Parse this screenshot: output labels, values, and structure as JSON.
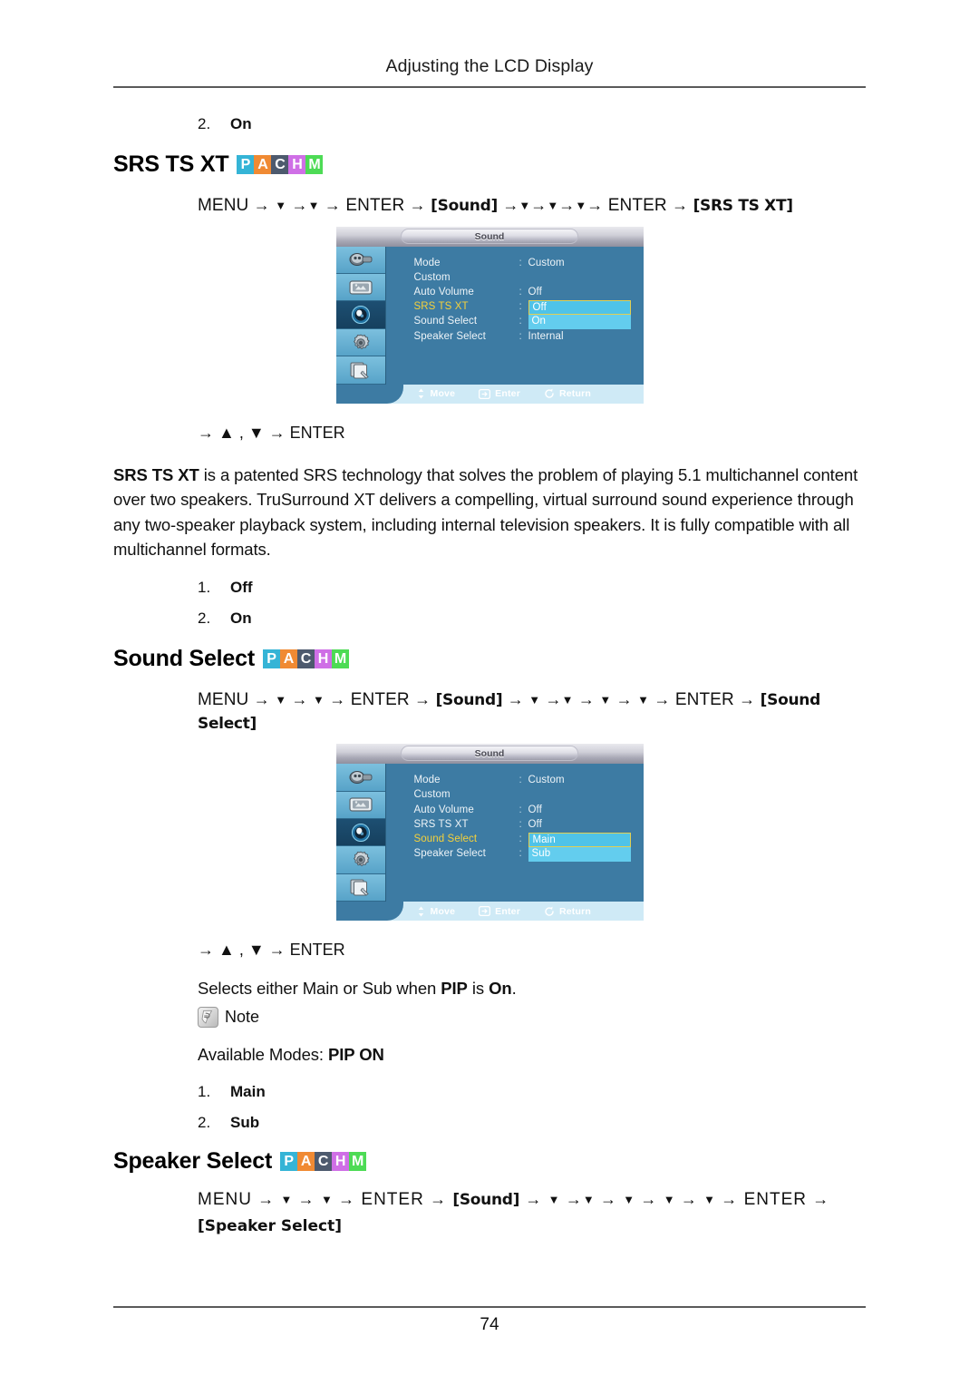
{
  "header": {
    "title": "Adjusting the LCD Display"
  },
  "footer": {
    "page_number": "74"
  },
  "badge_colors": {
    "P": "#35b4d6",
    "A": "#f08a33",
    "C": "#4d5a6e",
    "H": "#cf6fe6",
    "M": "#4ddb55"
  },
  "badges": [
    {
      "letter": "P",
      "name": "badge-p"
    },
    {
      "letter": "A",
      "name": "badge-a"
    },
    {
      "letter": "C",
      "name": "badge-c"
    },
    {
      "letter": "H",
      "name": "badge-h"
    },
    {
      "letter": "M",
      "name": "badge-m"
    }
  ],
  "top_list": {
    "num": "2.",
    "value": "On"
  },
  "srs": {
    "heading": "SRS TS XT",
    "path": {
      "menu": "MENU",
      "enter1": "ENTER",
      "sound": "[Sound]",
      "enter2": "ENTER",
      "target": "[SRS TS XT]",
      "arrow": "→",
      "down": "▼"
    },
    "kbd_line": "→ ▲ , ▼ → ENTER",
    "description_bold": "SRS TS XT",
    "description": " is a patented SRS technology that solves the problem of playing 5.1 multichannel content over two speakers. TruSurround XT delivers a compelling, virtual surround sound experience through any two-speaker playback system, including internal television speakers. It is fully compatible with all multichannel formats.",
    "options": [
      {
        "num": "1.",
        "value": "Off"
      },
      {
        "num": "2.",
        "value": "On"
      }
    ],
    "osd": {
      "title": "Sound",
      "rows": [
        {
          "label": "Mode",
          "colon": ":",
          "value": "Custom",
          "state": "plain",
          "selected": false
        },
        {
          "label": "Custom",
          "colon": "",
          "value": "",
          "state": "plain",
          "selected": false
        },
        {
          "label": "Auto Volume",
          "colon": ":",
          "value": "Off",
          "state": "plain",
          "selected": false
        },
        {
          "label": "SRS TS XT",
          "colon": ":",
          "value": "Off",
          "state": "cursor",
          "selected": true
        },
        {
          "label": "Sound Select",
          "colon": ":",
          "value": "On",
          "state": "hl",
          "selected": false
        },
        {
          "label": "Speaker Select",
          "colon": ":",
          "value": "Internal",
          "state": "plain",
          "selected": false
        }
      ],
      "footer": [
        {
          "icon": "move-icon",
          "label": "Move"
        },
        {
          "icon": "enter-icon",
          "label": "Enter"
        },
        {
          "icon": "return-icon",
          "label": "Return"
        }
      ],
      "sidebar_icons": [
        {
          "name": "input-source-icon",
          "active": false
        },
        {
          "name": "picture-icon",
          "active": false
        },
        {
          "name": "sound-icon",
          "active": true
        },
        {
          "name": "setup-gear-icon",
          "active": false
        },
        {
          "name": "multi-control-icon",
          "active": false
        }
      ]
    }
  },
  "sound_select": {
    "heading": "Sound Select",
    "path": {
      "menu": "MENU",
      "enter1": "ENTER",
      "sound": "[Sound]",
      "enter2": "ENTER",
      "target": "[Sound Select]",
      "arrow": "→",
      "down": "▼"
    },
    "kbd_line": "→ ▲ , ▼ → ENTER",
    "description_pre": "Selects either Main or Sub when ",
    "description_b1": "PIP",
    "description_mid": " is ",
    "description_b2": "On",
    "description_post": ".",
    "note_label": "Note",
    "available_modes_label": "Available Modes: ",
    "available_modes_value": "PIP ON",
    "options": [
      {
        "num": "1.",
        "value": "Main"
      },
      {
        "num": "2.",
        "value": "Sub"
      }
    ],
    "osd": {
      "title": "Sound",
      "rows": [
        {
          "label": "Mode",
          "colon": ":",
          "value": "Custom",
          "state": "plain",
          "selected": false
        },
        {
          "label": "Custom",
          "colon": "",
          "value": "",
          "state": "plain",
          "selected": false
        },
        {
          "label": "Auto Volume",
          "colon": ":",
          "value": "Off",
          "state": "plain",
          "selected": false
        },
        {
          "label": "SRS TS XT",
          "colon": ":",
          "value": "Off",
          "state": "plain",
          "selected": false
        },
        {
          "label": "Sound Select",
          "colon": ":",
          "value": "Main",
          "state": "cursor",
          "selected": true
        },
        {
          "label": "Speaker Select",
          "colon": ":",
          "value": "Sub",
          "state": "hl",
          "selected": false
        }
      ],
      "footer": [
        {
          "icon": "move-icon",
          "label": "Move"
        },
        {
          "icon": "enter-icon",
          "label": "Enter"
        },
        {
          "icon": "return-icon",
          "label": "Return"
        }
      ],
      "sidebar_icons": [
        {
          "name": "input-source-icon",
          "active": false
        },
        {
          "name": "picture-icon",
          "active": false
        },
        {
          "name": "sound-icon",
          "active": true
        },
        {
          "name": "setup-gear-icon",
          "active": false
        },
        {
          "name": "multi-control-icon",
          "active": false
        }
      ]
    }
  },
  "speaker_select": {
    "heading": "Speaker Select",
    "path": {
      "menu": "MENU",
      "enter1": "ENTER",
      "sound": "[Sound]",
      "enter2": "ENTER",
      "target": "[Speaker Select]",
      "arrow": "→",
      "down": "▼"
    }
  }
}
